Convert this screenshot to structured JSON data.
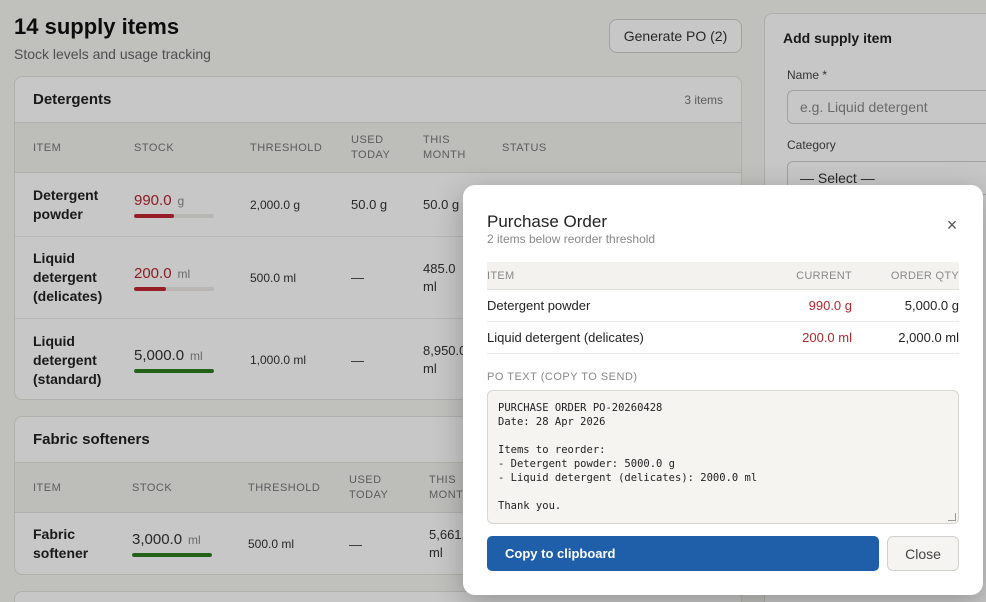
{
  "header": {
    "title": "14 supply items",
    "subtitle": "Stock levels and usage tracking",
    "generate_po_label": "Generate PO (2)"
  },
  "columns": {
    "item": "ITEM",
    "stock": "STOCK",
    "threshold": "THRESHOLD",
    "used_today": "USED TODAY",
    "this_month": "THIS MONTH",
    "status": "STATUS"
  },
  "categories": [
    {
      "title": "Detergents",
      "count": "3 items",
      "rows": [
        {
          "name": "Detergent powder",
          "stock": "990.0",
          "unit": "g",
          "threshold": "2,000.0 g",
          "used_today": "50.0 g",
          "this_month": "50.0 g",
          "stock_fraction": 0.495,
          "status": "low"
        },
        {
          "name": "Liquid detergent (delicates)",
          "stock": "200.0",
          "unit": "ml",
          "threshold": "500.0 ml",
          "used_today": "—",
          "this_month": "485.0 ml",
          "stock_fraction": 0.4,
          "status": "low"
        },
        {
          "name": "Liquid detergent (standard)",
          "stock": "5,000.0",
          "unit": "ml",
          "threshold": "1,000.0 ml",
          "used_today": "—",
          "this_month": "8,950.0 ml",
          "stock_fraction": 1.0,
          "status": "ok"
        }
      ]
    },
    {
      "title": "Fabric softeners",
      "rows": [
        {
          "name": "Fabric softener",
          "stock": "3,000.0",
          "unit": "ml",
          "threshold": "500.0 ml",
          "used_today": "—",
          "this_month": "5,661.0 ml",
          "stock_fraction": 1.0,
          "status": "ok"
        }
      ]
    }
  ],
  "side_panel": {
    "title": "Add supply item",
    "name_label": "Name *",
    "name_placeholder": "e.g. Liquid detergent",
    "category_label": "Category",
    "category_value": "— Select —"
  },
  "modal": {
    "title": "Purchase Order",
    "subtitle": "2 items below reorder threshold",
    "columns": {
      "item": "ITEM",
      "current": "CURRENT",
      "order_qty": "ORDER QTY"
    },
    "rows": [
      {
        "item": "Detergent powder",
        "current": "990.0 g",
        "order_qty": "5,000.0 g"
      },
      {
        "item": "Liquid detergent (delicates)",
        "current": "200.0 ml",
        "order_qty": "2,000.0 ml"
      }
    ],
    "po_text_label": "PO TEXT (COPY TO SEND)",
    "po_text": "PURCHASE ORDER PO-20260428\nDate: 28 Apr 2026\n\nItems to reorder:\n- Detergent powder: 5000.0 g\n- Liquid detergent (delicates): 2000.0 ml\n\nThank you.",
    "copy_label": "Copy to clipboard",
    "close_label": "Close",
    "close_icon": "×"
  },
  "colors": {
    "accent": "#1f5ea8",
    "low_stock": "#b3262d",
    "ok_stock": "#2e7d1f"
  }
}
